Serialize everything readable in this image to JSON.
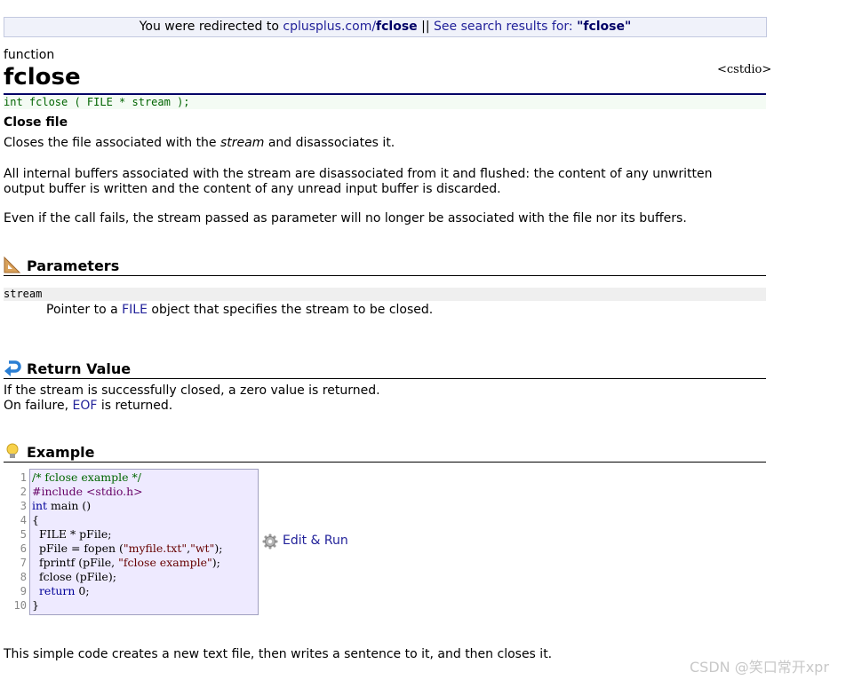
{
  "redirect": {
    "prefix": "You were redirected to ",
    "site": "cplusplus.com/",
    "site_bold": "fclose",
    "separator": " || ",
    "search_text": "See search results for: ",
    "search_term": "\"fclose\""
  },
  "entry": {
    "kind": "function",
    "name": "fclose",
    "header": "<cstdio>",
    "prototype": "int fclose ( FILE * stream );",
    "short_desc": "Close file"
  },
  "description": {
    "p1_before": "Closes the file associated with the ",
    "p1_em": "stream",
    "p1_after": " and disassociates it.",
    "p2_line1": "All internal buffers associated with the stream are disassociated from it and flushed: the content of any unwritten",
    "p2_line2": "output buffer is written and the content of any unread input buffer is discarded.",
    "p3": "Even if the call fails, the stream passed as parameter will no longer be associated with the file nor its buffers."
  },
  "sections": {
    "parameters": "Parameters",
    "return_value": "Return Value",
    "example": "Example"
  },
  "parameters": {
    "name": "stream",
    "desc_before": "Pointer to a ",
    "desc_link": "FILE",
    "desc_after": " object that specifies the stream to be closed."
  },
  "return_value": {
    "line1": "If the stream is successfully closed, a zero value is returned.",
    "line2_before": "On failure, ",
    "line2_link": "EOF",
    "line2_after": " is returned."
  },
  "example": {
    "line_numbers": [
      "1",
      "2",
      "3",
      "4",
      "5",
      "6",
      "7",
      "8",
      "9",
      "10"
    ],
    "code": {
      "l1": "/* fclose example */",
      "l2": "#include <stdio.h>",
      "l3_kw": "int",
      "l3_rest": " main ()",
      "l4": "{",
      "l5": "  FILE * pFile;",
      "l6_a": "  pFile = fopen (",
      "l6_s1": "\"myfile.txt\"",
      "l6_b": ",",
      "l6_s2": "\"wt\"",
      "l6_c": ");",
      "l7_a": "  fprintf (pFile, ",
      "l7_s": "\"fclose example\"",
      "l7_b": ");",
      "l8": "  fclose (pFile);",
      "l9_kw": "  return",
      "l9_rest": " 0;",
      "l10": "}"
    },
    "edit_run": "Edit & Run",
    "caption": "This simple code creates a new text file, then writes a sentence to it, and then closes it."
  },
  "watermark": "CSDN @笑口常开xpr",
  "icons": {
    "parameters": "ruler-triangle-icon",
    "return_value": "return-arrow-icon",
    "example": "lightbulb-icon",
    "edit_run": "gear-icon"
  }
}
